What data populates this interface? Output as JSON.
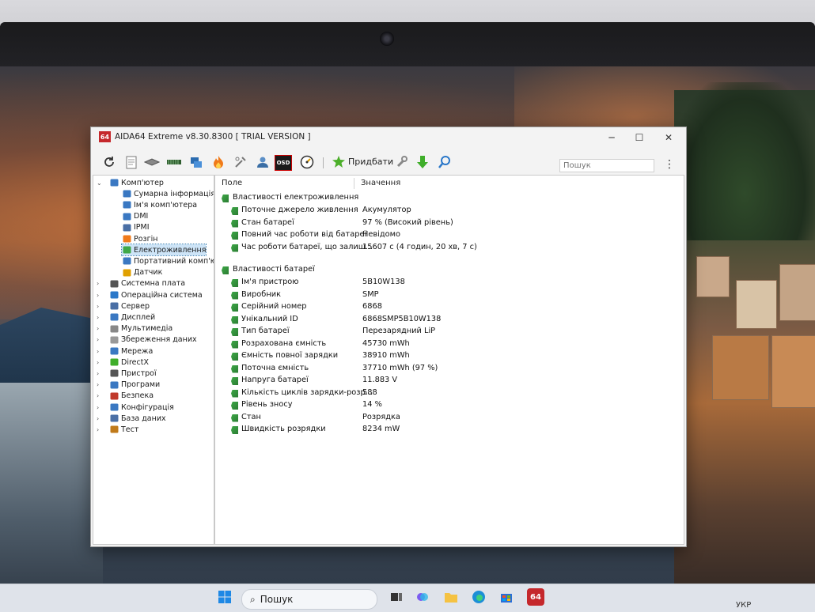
{
  "window": {
    "app_icon_text": "64",
    "title": "AIDA64 Extreme v8.30.8300  [ TRIAL VERSION ]",
    "minimize_glyph": "─",
    "maximize_glyph": "☐",
    "close_glyph": "✕"
  },
  "toolbar": {
    "add_label": "Придбати",
    "search_placeholder": "Пошук",
    "osd_label": "OSD",
    "icons": [
      "refresh-icon",
      "report-icon",
      "memory-icon",
      "motherboard-icon",
      "network-icon",
      "flame-icon",
      "tools-icon",
      "user-icon",
      "osd-icon",
      "gauge-icon",
      "add-icon",
      "wrench-icon",
      "download-icon",
      "search-icon"
    ]
  },
  "tree": {
    "items": [
      {
        "label": "Комп'ютер",
        "level": 0,
        "expander": "⌄",
        "icon": "computer-icon"
      },
      {
        "label": "Сумарна інформація",
        "level": 1,
        "icon": "summary-icon"
      },
      {
        "label": "Ім'я комп'ютера",
        "level": 1,
        "icon": "computer-name-icon"
      },
      {
        "label": "DMI",
        "level": 1,
        "icon": "dmi-icon"
      },
      {
        "label": "IPMI",
        "level": 1,
        "icon": "ipmi-icon"
      },
      {
        "label": "Розгін",
        "level": 1,
        "icon": "overclock-icon"
      },
      {
        "label": "Електроживлення",
        "level": 1,
        "icon": "power-icon",
        "selected": true
      },
      {
        "label": "Портативний комп'юте",
        "level": 1,
        "icon": "portable-icon"
      },
      {
        "label": "Датчик",
        "level": 1,
        "icon": "sensor-icon"
      },
      {
        "label": "Системна плата",
        "level": 0,
        "expander": "›",
        "icon": "motherboard-icon"
      },
      {
        "label": "Операційна система",
        "level": 0,
        "expander": "›",
        "icon": "os-icon"
      },
      {
        "label": "Сервер",
        "level": 0,
        "expander": "›",
        "icon": "server-icon"
      },
      {
        "label": "Дисплей",
        "level": 0,
        "expander": "›",
        "icon": "display-icon"
      },
      {
        "label": "Мультимедіа",
        "level": 0,
        "expander": "›",
        "icon": "multimedia-icon"
      },
      {
        "label": "Збереження даних",
        "level": 0,
        "expander": "›",
        "icon": "storage-icon"
      },
      {
        "label": "Мережа",
        "level": 0,
        "expander": "›",
        "icon": "network-icon"
      },
      {
        "label": "DirectX",
        "level": 0,
        "expander": "›",
        "icon": "directx-icon"
      },
      {
        "label": "Пристрої",
        "level": 0,
        "expander": "›",
        "icon": "devices-icon"
      },
      {
        "label": "Програми",
        "level": 0,
        "expander": "›",
        "icon": "programs-icon"
      },
      {
        "label": "Безпека",
        "level": 0,
        "expander": "›",
        "icon": "security-icon"
      },
      {
        "label": "Конфігурація",
        "level": 0,
        "expander": "›",
        "icon": "config-icon"
      },
      {
        "label": "База даних",
        "level": 0,
        "expander": "›",
        "icon": "database-icon"
      },
      {
        "label": "Тест",
        "level": 0,
        "expander": "›",
        "icon": "test-icon"
      }
    ]
  },
  "list": {
    "columns": [
      "Поле",
      "Значення"
    ],
    "groups": [
      {
        "title": "Властивості електроживлення",
        "rows": [
          {
            "field": "Поточне джерело живлення",
            "value": "Акумулятор"
          },
          {
            "field": "Стан батареї",
            "value": "97 % (Високий рівень)"
          },
          {
            "field": "Повний час роботи від батареї",
            "value": "Невідомо"
          },
          {
            "field": "Час роботи батареї, що залиш...",
            "value": "15607 с (4 годин, 20 хв, 7 с)"
          }
        ]
      },
      {
        "title": "Властивості батареї",
        "rows": [
          {
            "field": "Ім'я пристрою",
            "value": "5B10W138"
          },
          {
            "field": "Виробник",
            "value": "SMP"
          },
          {
            "field": "Серійний номер",
            "value": "6868"
          },
          {
            "field": "Унікальний ID",
            "value": "6868SMP5B10W138"
          },
          {
            "field": "Тип батареї",
            "value": "Перезарядний LiP"
          },
          {
            "field": "Розрахована ємність",
            "value": "45730 mWh"
          },
          {
            "field": "Ємність повної зарядки",
            "value": "38910 mWh"
          },
          {
            "field": "Поточна ємність",
            "value": "37710 mWh  (97 %)"
          },
          {
            "field": "Напруга батареї",
            "value": "11.883 V"
          },
          {
            "field": "Кількість циклів зарядки-розр...",
            "value": "588"
          },
          {
            "field": "Рівень зносу",
            "value": "14 %"
          },
          {
            "field": "Стан",
            "value": "Розрядка"
          },
          {
            "field": "Швидкість розрядки",
            "value": "8234 mW"
          }
        ]
      }
    ]
  },
  "taskbar": {
    "search_label": "Пошук",
    "tray_text": "УКР"
  },
  "colors": {
    "accent": "#0078d4",
    "selection_bg": "#cde4f7",
    "group_icon": "#3ea847"
  }
}
